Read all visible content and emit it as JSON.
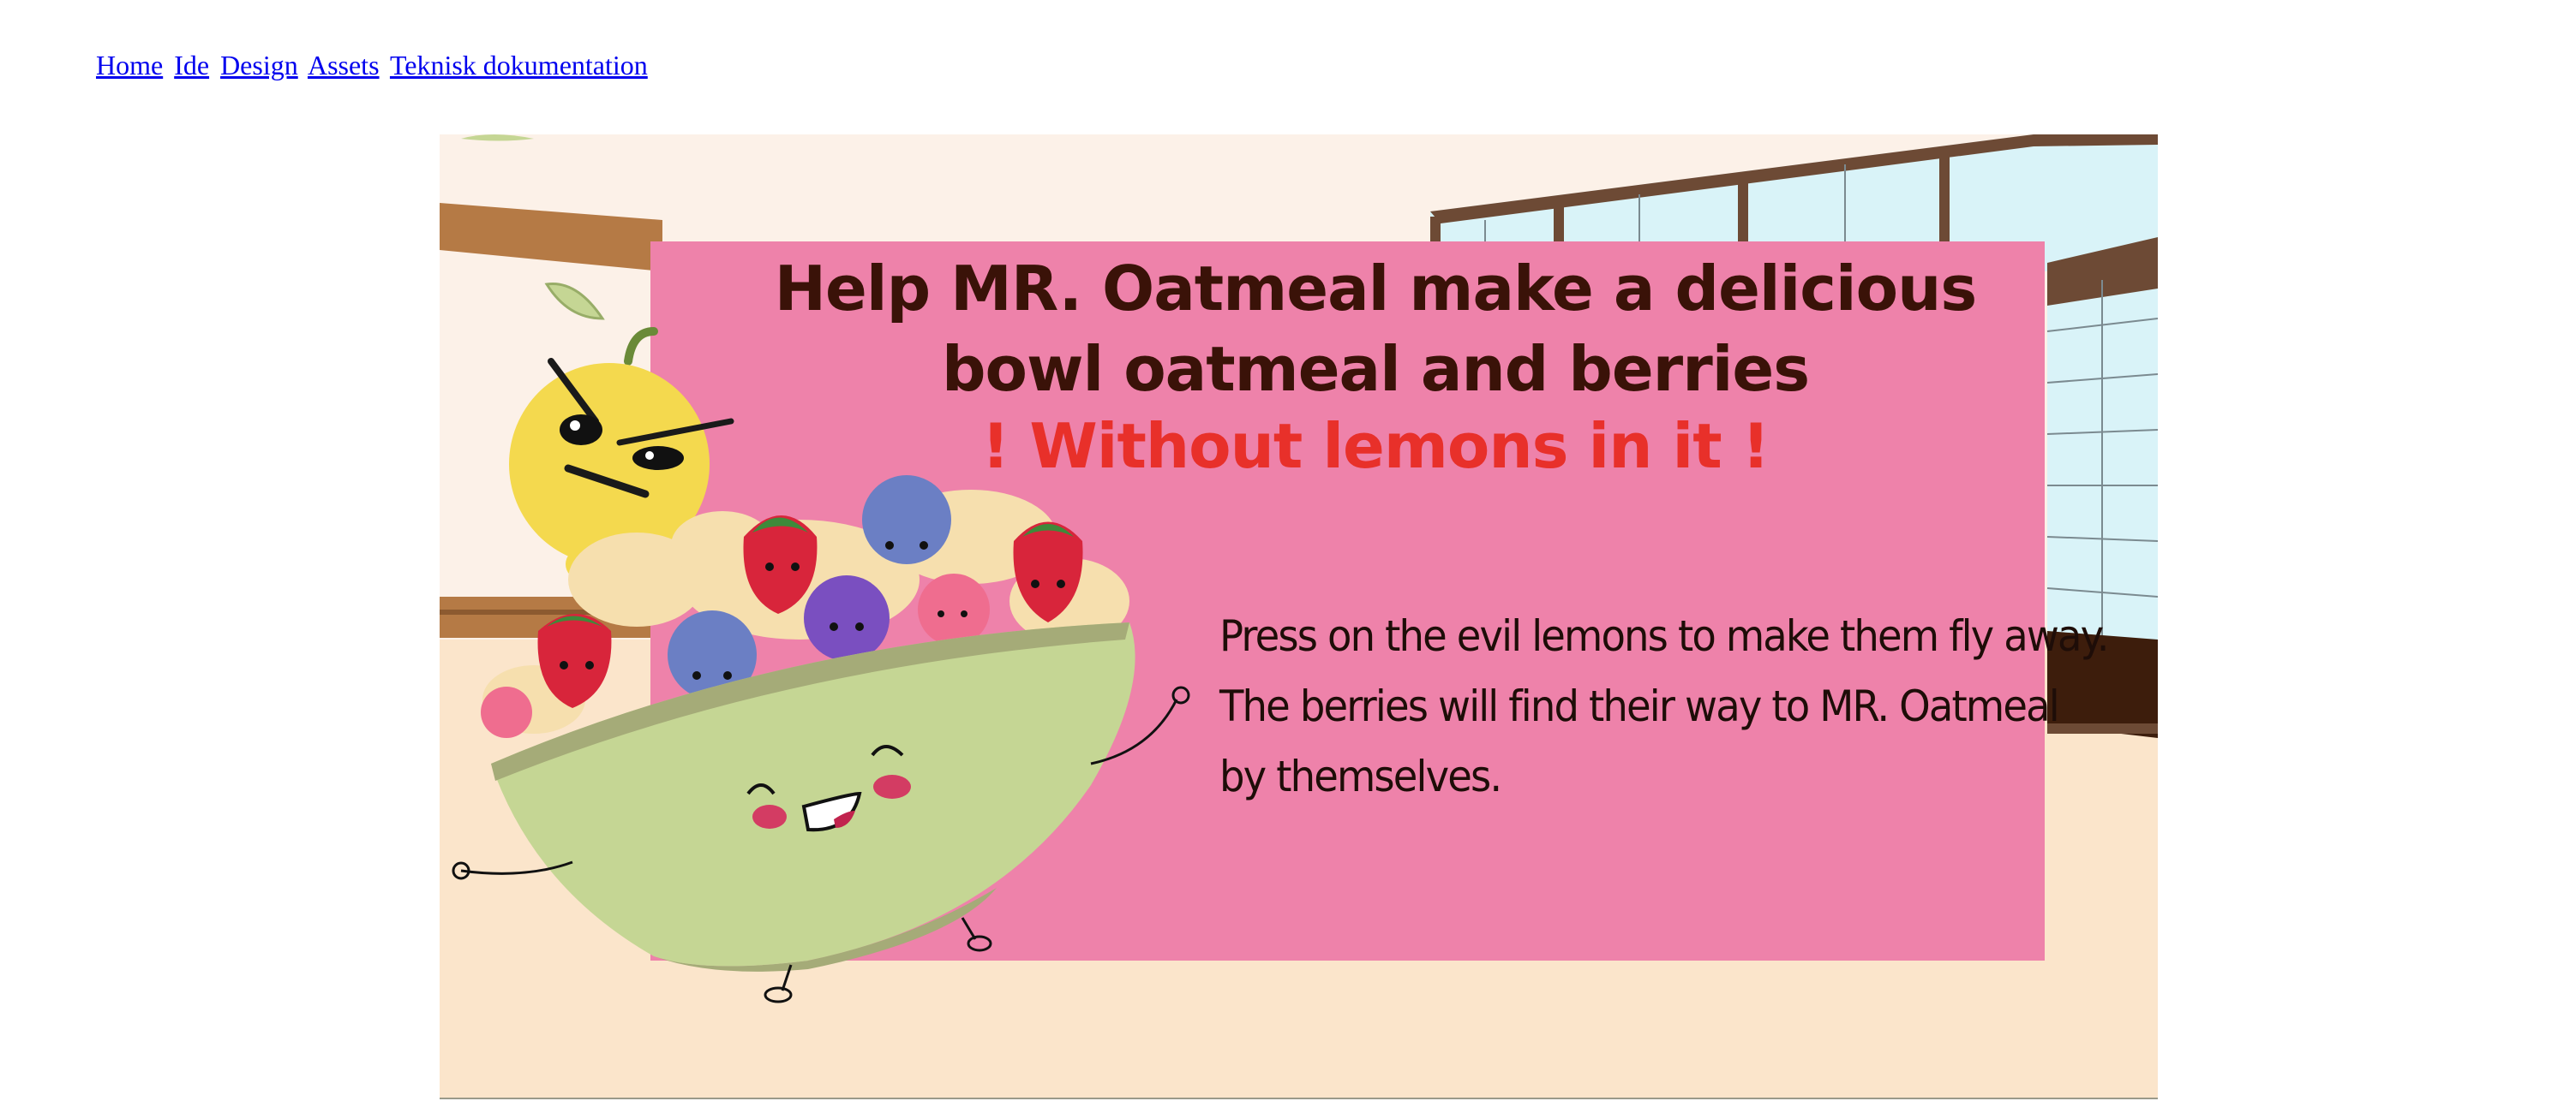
{
  "nav": {
    "links": [
      "Home",
      "Ide",
      "Design",
      "Assets",
      "Teknisk dokumentation"
    ]
  },
  "game": {
    "title_line1": "Help MR. Oatmeal make a delicious",
    "title_line2": "bowl oatmeal and berries",
    "warning": "! Without lemons in it !",
    "instructions_line1": "Press on the evil lemons to make them fly away.",
    "instructions_line2": "The berries will find their way to MR. Oatmeal",
    "instructions_line3": "by themselves."
  },
  "colors": {
    "panel": "#ee82aa",
    "title": "#3a1208",
    "warning": "#e8302a",
    "link": "#0000ee",
    "bowl": "#c5d694",
    "lemon": "#f4d94e"
  },
  "icons": [
    "lemon-icon",
    "strawberry-icon",
    "blueberry-icon",
    "blackberry-icon",
    "raspberry-icon",
    "oatmeal-bowl-icon"
  ]
}
